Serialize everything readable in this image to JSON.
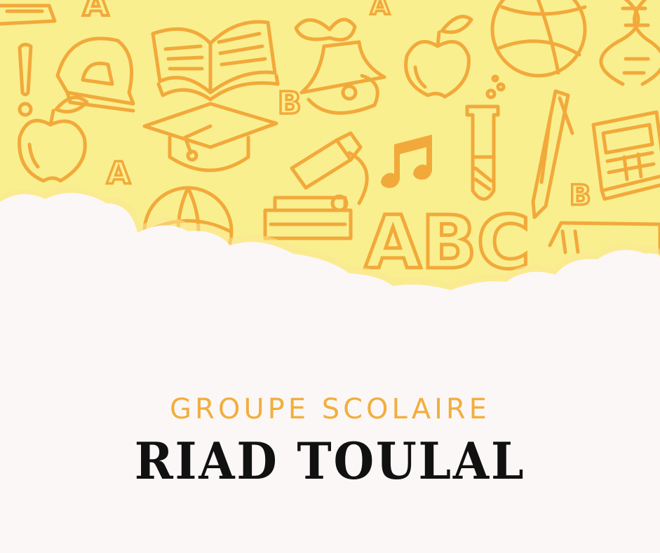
{
  "poster": {
    "subtitle": "GROUPE SCOLAIRE",
    "title": "RIAD TOULAL"
  },
  "colors": {
    "background_yellow": "#f9ef8f",
    "doodle_orange": "#f2a93b",
    "cloud_white": "#fbf7f7",
    "subtitle_orange": "#f2ae3c",
    "title_black": "#111111"
  },
  "doodles": {
    "icons": [
      "apple-icon",
      "book-icon",
      "protractor-icon",
      "bell-icon",
      "globe-icon",
      "dna-icon",
      "exclamation-icon",
      "graduation-cap-icon",
      "microscope-icon",
      "music-note-icon",
      "test-tube-icon",
      "pencil-icon",
      "calculator-icon"
    ],
    "letters": [
      "A",
      "B",
      "A",
      "B",
      "A",
      "B",
      "ABC"
    ]
  }
}
